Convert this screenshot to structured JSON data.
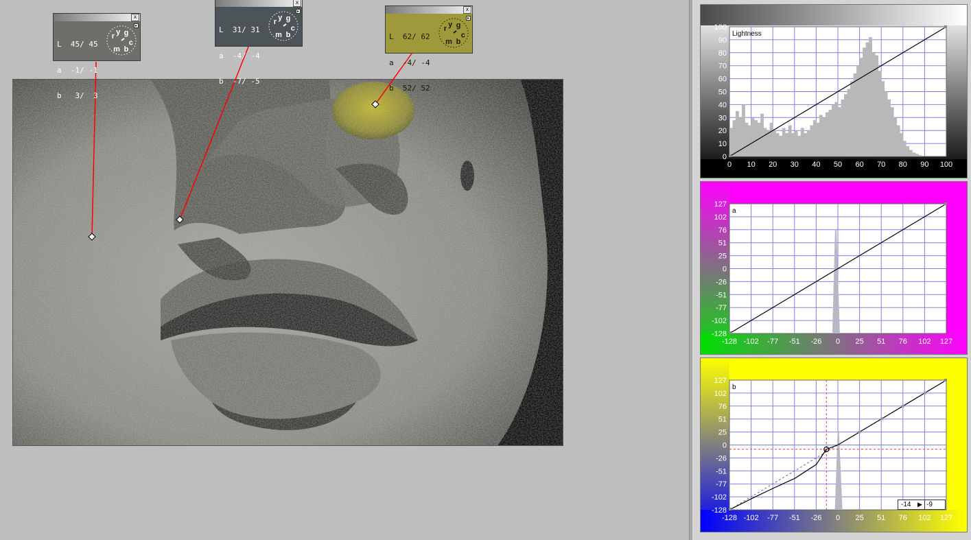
{
  "samplers": [
    {
      "id": "s1",
      "lines": [
        "L  45/ 45",
        "a  -1/ -1",
        "b   3/  3"
      ],
      "bg": "#6e6e6a",
      "text": "#ffffff",
      "dial_letters": [
        "r",
        "y",
        "g",
        "c",
        "b",
        "m"
      ],
      "close": "x",
      "menu": "▸"
    },
    {
      "id": "s2",
      "lines": [
        "L  31/ 31",
        "a  -4/ -4",
        "b  -7/ -5"
      ],
      "bg": "#4c5458",
      "text": "#ffffff",
      "dial_letters": [
        "r",
        "y",
        "g",
        "c",
        "b",
        "m"
      ],
      "close": "x",
      "menu": "▸"
    },
    {
      "id": "s3",
      "lines": [
        "L  62/ 62",
        "a  -4/ -4",
        "b  52/ 52"
      ],
      "bg": "#9e9a3c",
      "text": "#1a1a00",
      "dial_letters": [
        "r",
        "y",
        "g",
        "c",
        "b",
        "m"
      ],
      "close": "x",
      "menu": "▸"
    }
  ],
  "panels": {
    "lightness": {
      "label": "Lightness",
      "handle": "◆",
      "x_ticks": [
        "0",
        "10",
        "20",
        "30",
        "40",
        "50",
        "60",
        "70",
        "80",
        "90",
        "100"
      ],
      "y_ticks": [
        "100",
        "90",
        "80",
        "70",
        "60",
        "50",
        "40",
        "30",
        "20",
        "10",
        "0"
      ],
      "bg_top": "#ffffff",
      "bg_bottom": "#000000"
    },
    "a": {
      "label": "a",
      "handle": "◆",
      "x_ticks": [
        "-128",
        "-102",
        "-77",
        "-51",
        "-26",
        "0",
        "25",
        "51",
        "76",
        "102",
        "127"
      ],
      "y_ticks": [
        "127",
        "102",
        "76",
        "51",
        "25",
        "0",
        "-26",
        "-51",
        "-77",
        "-102",
        "-128"
      ],
      "bg_left": "#00e000",
      "bg_right": "#ff00ff"
    },
    "b": {
      "label": "b",
      "handle": "◆",
      "x_ticks": [
        "-128",
        "-102",
        "-77",
        "-51",
        "-26",
        "0",
        "25",
        "51",
        "76",
        "102",
        "127"
      ],
      "y_ticks": [
        "127",
        "102",
        "76",
        "51",
        "25",
        "0",
        "-26",
        "-51",
        "-77",
        "-102",
        "-128"
      ],
      "bg_left": "#0000ff",
      "bg_right": "#ffff00",
      "point_in": "-14",
      "point_arrow": "▶",
      "point_out": "-9"
    }
  },
  "chart_data": [
    {
      "type": "area",
      "ylabel": "Lightness",
      "xlim": [
        0,
        100
      ],
      "ylim": [
        0,
        100
      ],
      "curve": [
        [
          0,
          0
        ],
        [
          100,
          100
        ]
      ],
      "histogram": [
        22,
        28,
        35,
        30,
        40,
        26,
        24,
        30,
        28,
        26,
        33,
        22,
        20,
        26,
        20,
        18,
        16,
        22,
        18,
        24,
        18,
        20,
        16,
        22,
        18,
        20,
        24,
        28,
        26,
        32,
        30,
        34,
        36,
        40,
        42,
        38,
        44,
        48,
        52,
        58,
        64,
        70,
        76,
        84,
        88,
        92,
        80,
        78,
        66,
        58,
        50,
        44,
        38,
        30,
        24,
        18,
        12,
        8,
        5,
        3,
        2,
        1,
        0,
        0,
        0,
        0,
        0,
        0,
        0,
        0
      ],
      "histogram_x_range": [
        0,
        100
      ],
      "histogram_y_range": [
        0,
        100
      ]
    },
    {
      "type": "area",
      "ylabel": "a",
      "xlim": [
        -128,
        127
      ],
      "ylim": [
        -128,
        127
      ],
      "curve": [
        [
          -128,
          -128
        ],
        [
          127,
          127
        ]
      ],
      "spike": {
        "x": -3,
        "height": 80
      }
    },
    {
      "type": "area",
      "ylabel": "b",
      "xlim": [
        -128,
        127
      ],
      "ylim": [
        -128,
        127
      ],
      "curve": [
        [
          -128,
          -128
        ],
        [
          -102,
          -106
        ],
        [
          -77,
          -86
        ],
        [
          -51,
          -66
        ],
        [
          -26,
          -39
        ],
        [
          -14,
          -9
        ],
        [
          0,
          0
        ],
        [
          25,
          25
        ],
        [
          51,
          51
        ],
        [
          76,
          76
        ],
        [
          102,
          102
        ],
        [
          127,
          127
        ]
      ],
      "identity_dashed": true,
      "selected_point": [
        -14,
        -9
      ],
      "spike": {
        "x": 0,
        "height": 60
      }
    }
  ]
}
